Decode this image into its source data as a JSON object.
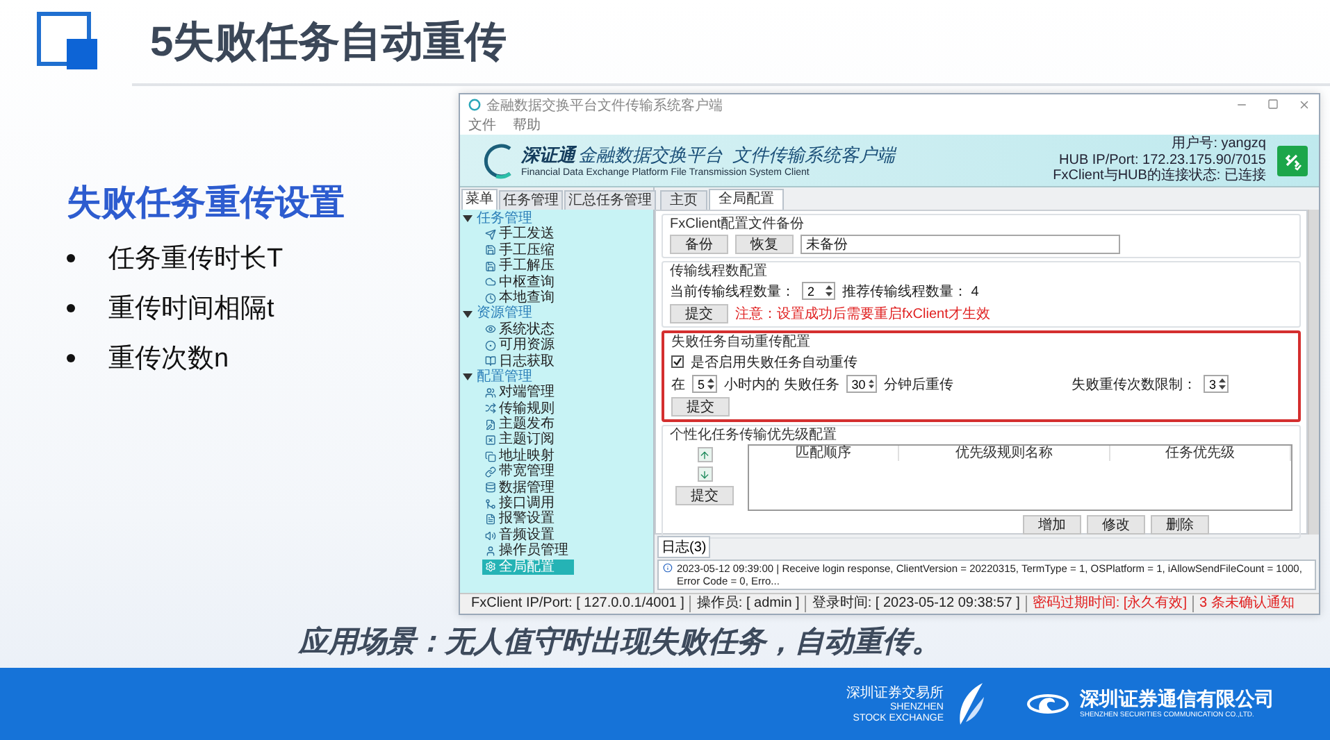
{
  "slide": {
    "title": "5失败任务自动重传",
    "heading": "失败任务重传设置",
    "bullets": [
      "任务重传时长T",
      "重传时间相隔t",
      "重传次数n"
    ],
    "caption": "应用场景：无人值守时出现失败任务，自动重传。",
    "logos": [
      {
        "kind": "exchange",
        "name": "深圳证券交易所",
        "english": [
          "SHENZHEN",
          "STOCK EXCHANGE"
        ]
      },
      {
        "kind": "company",
        "name": "深圳证券通信有限公司",
        "english": [
          "SHENZHEN SECURITIES COMMUNICATION CO.,LTD."
        ]
      }
    ]
  },
  "app": {
    "window": {
      "title": "金融数据交换平台文件传输系统客户端"
    },
    "menu": [
      "文件",
      "帮助"
    ],
    "banner": {
      "brand": "深证通",
      "name": "金融数据交换平台  文件传输系统客户端",
      "subtitle": "Financial Data Exchange Platform File Transmission System Client",
      "user": "用户号: yangzq",
      "hub": "HUB IP/Port: 172.23.175.90/7015",
      "connection": "FxClient与HUB的连接状态: 已连接"
    },
    "sidebar": {
      "tabs": [
        {
          "label": "菜单",
          "selected": true
        },
        {
          "label": "任务管理",
          "selected": false
        },
        {
          "label": "汇总任务管理",
          "selected": false
        }
      ],
      "tree": [
        {
          "label": "任务管理",
          "expanded": true,
          "children": [
            {
              "label": "手工发送",
              "selected": false
            },
            {
              "label": "手工压缩",
              "selected": false
            },
            {
              "label": "手工解压",
              "selected": false
            },
            {
              "label": "中枢查询",
              "selected": false
            },
            {
              "label": "本地查询",
              "selected": false
            }
          ]
        },
        {
          "label": "资源管理",
          "expanded": true,
          "children": [
            {
              "label": "系统状态",
              "selected": false
            },
            {
              "label": "可用资源",
              "selected": false
            },
            {
              "label": "日志获取",
              "selected": false
            }
          ]
        },
        {
          "label": "配置管理",
          "expanded": true,
          "children": [
            {
              "label": "对端管理",
              "selected": false
            },
            {
              "label": "传输规则",
              "selected": false
            },
            {
              "label": "主题发布",
              "selected": false
            },
            {
              "label": "主题订阅",
              "selected": false
            },
            {
              "label": "地址映射",
              "selected": false
            },
            {
              "label": "带宽管理",
              "selected": false
            },
            {
              "label": "数据管理",
              "selected": false
            },
            {
              "label": "接口调用",
              "selected": false
            },
            {
              "label": "报警设置",
              "selected": false
            },
            {
              "label": "音频设置",
              "selected": false
            },
            {
              "label": "操作员管理",
              "selected": false
            },
            {
              "label": "全局配置",
              "selected": true
            }
          ]
        }
      ]
    },
    "tabs": [
      {
        "label": "主页",
        "selected": false
      },
      {
        "label": "全局配置",
        "selected": true
      }
    ],
    "backup": {
      "title": "FxClient配置文件备份",
      "buttons": [
        "备份",
        "恢复"
      ],
      "value": "未备份"
    },
    "threads": {
      "title": "传输线程数配置",
      "label": "当前传输线程数量：",
      "value": "2",
      "recommended": "推荐传输线程数量： 4",
      "submit": "提交",
      "note": "注意：设置成功后需要重启fxClient才生效"
    },
    "retry": {
      "title": "失败任务自动重传配置",
      "highlighted": true,
      "enable": {
        "label": "是否启用失败任务自动重传",
        "checked": true
      },
      "prefix": "在",
      "hours": "5",
      "middle": "小时内的 失败任务",
      "minutes": "30",
      "suffix": "分钟后重传",
      "limit_label": "失败重传次数限制：",
      "limit": "3",
      "submit": "提交"
    },
    "priority": {
      "title": "个性化任务传输优先级配置",
      "columns": [
        "匹配顺序",
        "优先级规则名称",
        "任务优先级"
      ],
      "submit": "提交",
      "buttons": [
        "增加",
        "修改",
        "删除"
      ]
    },
    "log": {
      "tab": "日志(3)",
      "entries": [
        {
          "text": "2023-05-12 09:39:00  |  Receive login response, ClientVersion = 20220315, TermType = 1, OSPlatform = 1, iAllowSendFileCount = 1000, Error Code = 0, Erro..."
        }
      ]
    },
    "status_bar": [
      {
        "text": "FxClient IP/Port: [ 127.0.0.1/4001 ]",
        "alert": false
      },
      {
        "text": "操作员: [ admin ]",
        "alert": false
      },
      {
        "text": "登录时间: [ 2023-05-12 09:38:57 ]",
        "alert": false
      },
      {
        "text": "密码过期时间: [永久有效]",
        "alert": true
      },
      {
        "text": "3 条未确认通知",
        "alert": true
      }
    ]
  }
}
